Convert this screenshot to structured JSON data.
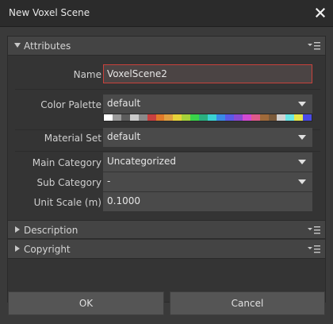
{
  "window": {
    "title": "New Voxel Scene"
  },
  "sections": {
    "attributes": {
      "label": "Attributes"
    },
    "description": {
      "label": "Description"
    },
    "copyright": {
      "label": "Copyright"
    }
  },
  "form": {
    "name": {
      "label": "Name",
      "value": "VoxelScene2"
    },
    "color_palette": {
      "label": "Color Palette",
      "value": "default",
      "swatches": [
        "#ffffff",
        "#9a9a9a",
        "#5c5c5c",
        "#c9c9c9",
        "#8a8a8a",
        "#c94040",
        "#e07a2a",
        "#e0a040",
        "#e6d23a",
        "#a6d23a",
        "#3ad24a",
        "#2ab080",
        "#3ad2d2",
        "#3a8ae6",
        "#5a5ae6",
        "#8a4ad2",
        "#d24ad2",
        "#e05a8a",
        "#a06a3a",
        "#7a5a3a",
        "#d2d2d2",
        "#6ae6e6",
        "#e6e64a",
        "#4a4ae6"
      ]
    },
    "material_set": {
      "label": "Material Set",
      "value": "default"
    },
    "main_category": {
      "label": "Main Category",
      "value": "Uncategorized"
    },
    "sub_category": {
      "label": "Sub Category",
      "value": "-"
    },
    "unit_scale": {
      "label": "Unit Scale (m)",
      "value": "0.1000"
    }
  },
  "buttons": {
    "ok": "OK",
    "cancel": "Cancel"
  },
  "icons": {
    "close": "close-icon",
    "section_menu": "section-menu-icon"
  },
  "colors": {
    "focus_border": "#c9413b",
    "background": "#3a3a3a",
    "titlebar": "#2b2b2b"
  }
}
